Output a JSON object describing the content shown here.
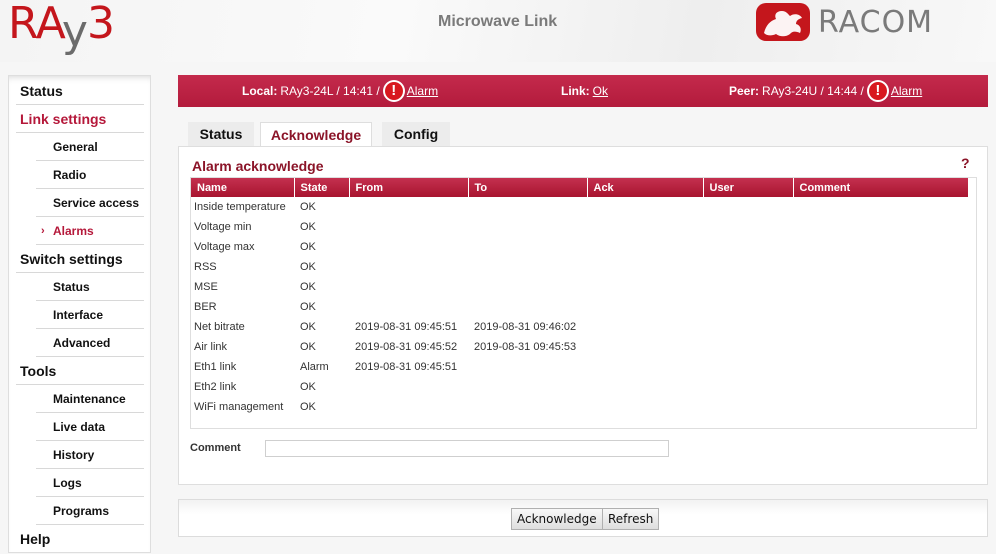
{
  "header": {
    "logo_left": {
      "part1": "RA",
      "part2": "y",
      "part3": "3"
    },
    "title": "Microwave Link",
    "logo_right_text": "RACOM"
  },
  "sidebar": {
    "items": [
      {
        "label": "Status",
        "type": "section"
      },
      {
        "label": "Link settings",
        "type": "section",
        "highlight": true
      },
      {
        "label": "General",
        "type": "sub"
      },
      {
        "label": "Radio",
        "type": "sub"
      },
      {
        "label": "Service access",
        "type": "sub"
      },
      {
        "label": "Alarms",
        "type": "sub",
        "active": true
      },
      {
        "label": "Switch settings",
        "type": "section"
      },
      {
        "label": "Status",
        "type": "sub"
      },
      {
        "label": "Interface",
        "type": "sub"
      },
      {
        "label": "Advanced",
        "type": "sub"
      },
      {
        "label": "Tools",
        "type": "section"
      },
      {
        "label": "Maintenance",
        "type": "sub"
      },
      {
        "label": "Live data",
        "type": "sub"
      },
      {
        "label": "History",
        "type": "sub"
      },
      {
        "label": "Logs",
        "type": "sub"
      },
      {
        "label": "Programs",
        "type": "sub"
      },
      {
        "label": "Help",
        "type": "section"
      }
    ],
    "active_marker": "›"
  },
  "statusbar": {
    "local_label": "Local:",
    "local_value": "RAy3-24L / 14:41 /",
    "local_alarm": "Alarm",
    "link_label": "Link:",
    "link_value": "Ok",
    "peer_label": "Peer:",
    "peer_value": "RAy3-24U / 14:44 /",
    "peer_alarm": "Alarm",
    "alarm_glyph": "!"
  },
  "tabs": [
    {
      "label": "Status"
    },
    {
      "label": "Acknowledge",
      "active": true
    },
    {
      "label": "Config"
    }
  ],
  "panel": {
    "title": "Alarm acknowledge",
    "help": "?",
    "columns": [
      "Name",
      "State",
      "From",
      "To",
      "Ack",
      "User",
      "Comment"
    ],
    "rows": [
      {
        "name": "Inside temperature",
        "state": "OK",
        "from": "",
        "to": "",
        "ack": "",
        "user": "",
        "comment": ""
      },
      {
        "name": "Voltage min",
        "state": "OK",
        "from": "",
        "to": "",
        "ack": "",
        "user": "",
        "comment": ""
      },
      {
        "name": "Voltage max",
        "state": "OK",
        "from": "",
        "to": "",
        "ack": "",
        "user": "",
        "comment": ""
      },
      {
        "name": "RSS",
        "state": "OK",
        "from": "",
        "to": "",
        "ack": "",
        "user": "",
        "comment": ""
      },
      {
        "name": "MSE",
        "state": "OK",
        "from": "",
        "to": "",
        "ack": "",
        "user": "",
        "comment": ""
      },
      {
        "name": "BER",
        "state": "OK",
        "from": "",
        "to": "",
        "ack": "",
        "user": "",
        "comment": ""
      },
      {
        "name": "Net bitrate",
        "state": "OK",
        "from": "2019-08-31 09:45:51",
        "to": "2019-08-31 09:46:02",
        "ack": "",
        "user": "",
        "comment": ""
      },
      {
        "name": "Air link",
        "state": "OK",
        "from": "2019-08-31 09:45:52",
        "to": "2019-08-31 09:45:53",
        "ack": "",
        "user": "",
        "comment": ""
      },
      {
        "name": "Eth1 link",
        "state": "Alarm",
        "from": "2019-08-31 09:45:51",
        "to": "",
        "ack": "",
        "user": "",
        "comment": ""
      },
      {
        "name": "Eth2 link",
        "state": "OK",
        "from": "",
        "to": "",
        "ack": "",
        "user": "",
        "comment": ""
      },
      {
        "name": "WiFi management",
        "state": "OK",
        "from": "",
        "to": "",
        "ack": "",
        "user": "",
        "comment": ""
      }
    ],
    "comment_label": "Comment",
    "comment_value": "",
    "comment_placeholder": ""
  },
  "buttons": {
    "acknowledge": "Acknowledge",
    "refresh": "Refresh"
  },
  "colors": {
    "brand_red": "#b5183a",
    "header_bar": "#b31b3c",
    "alarm_red": "#d8181f",
    "title_gray": "#7a7a7a"
  }
}
